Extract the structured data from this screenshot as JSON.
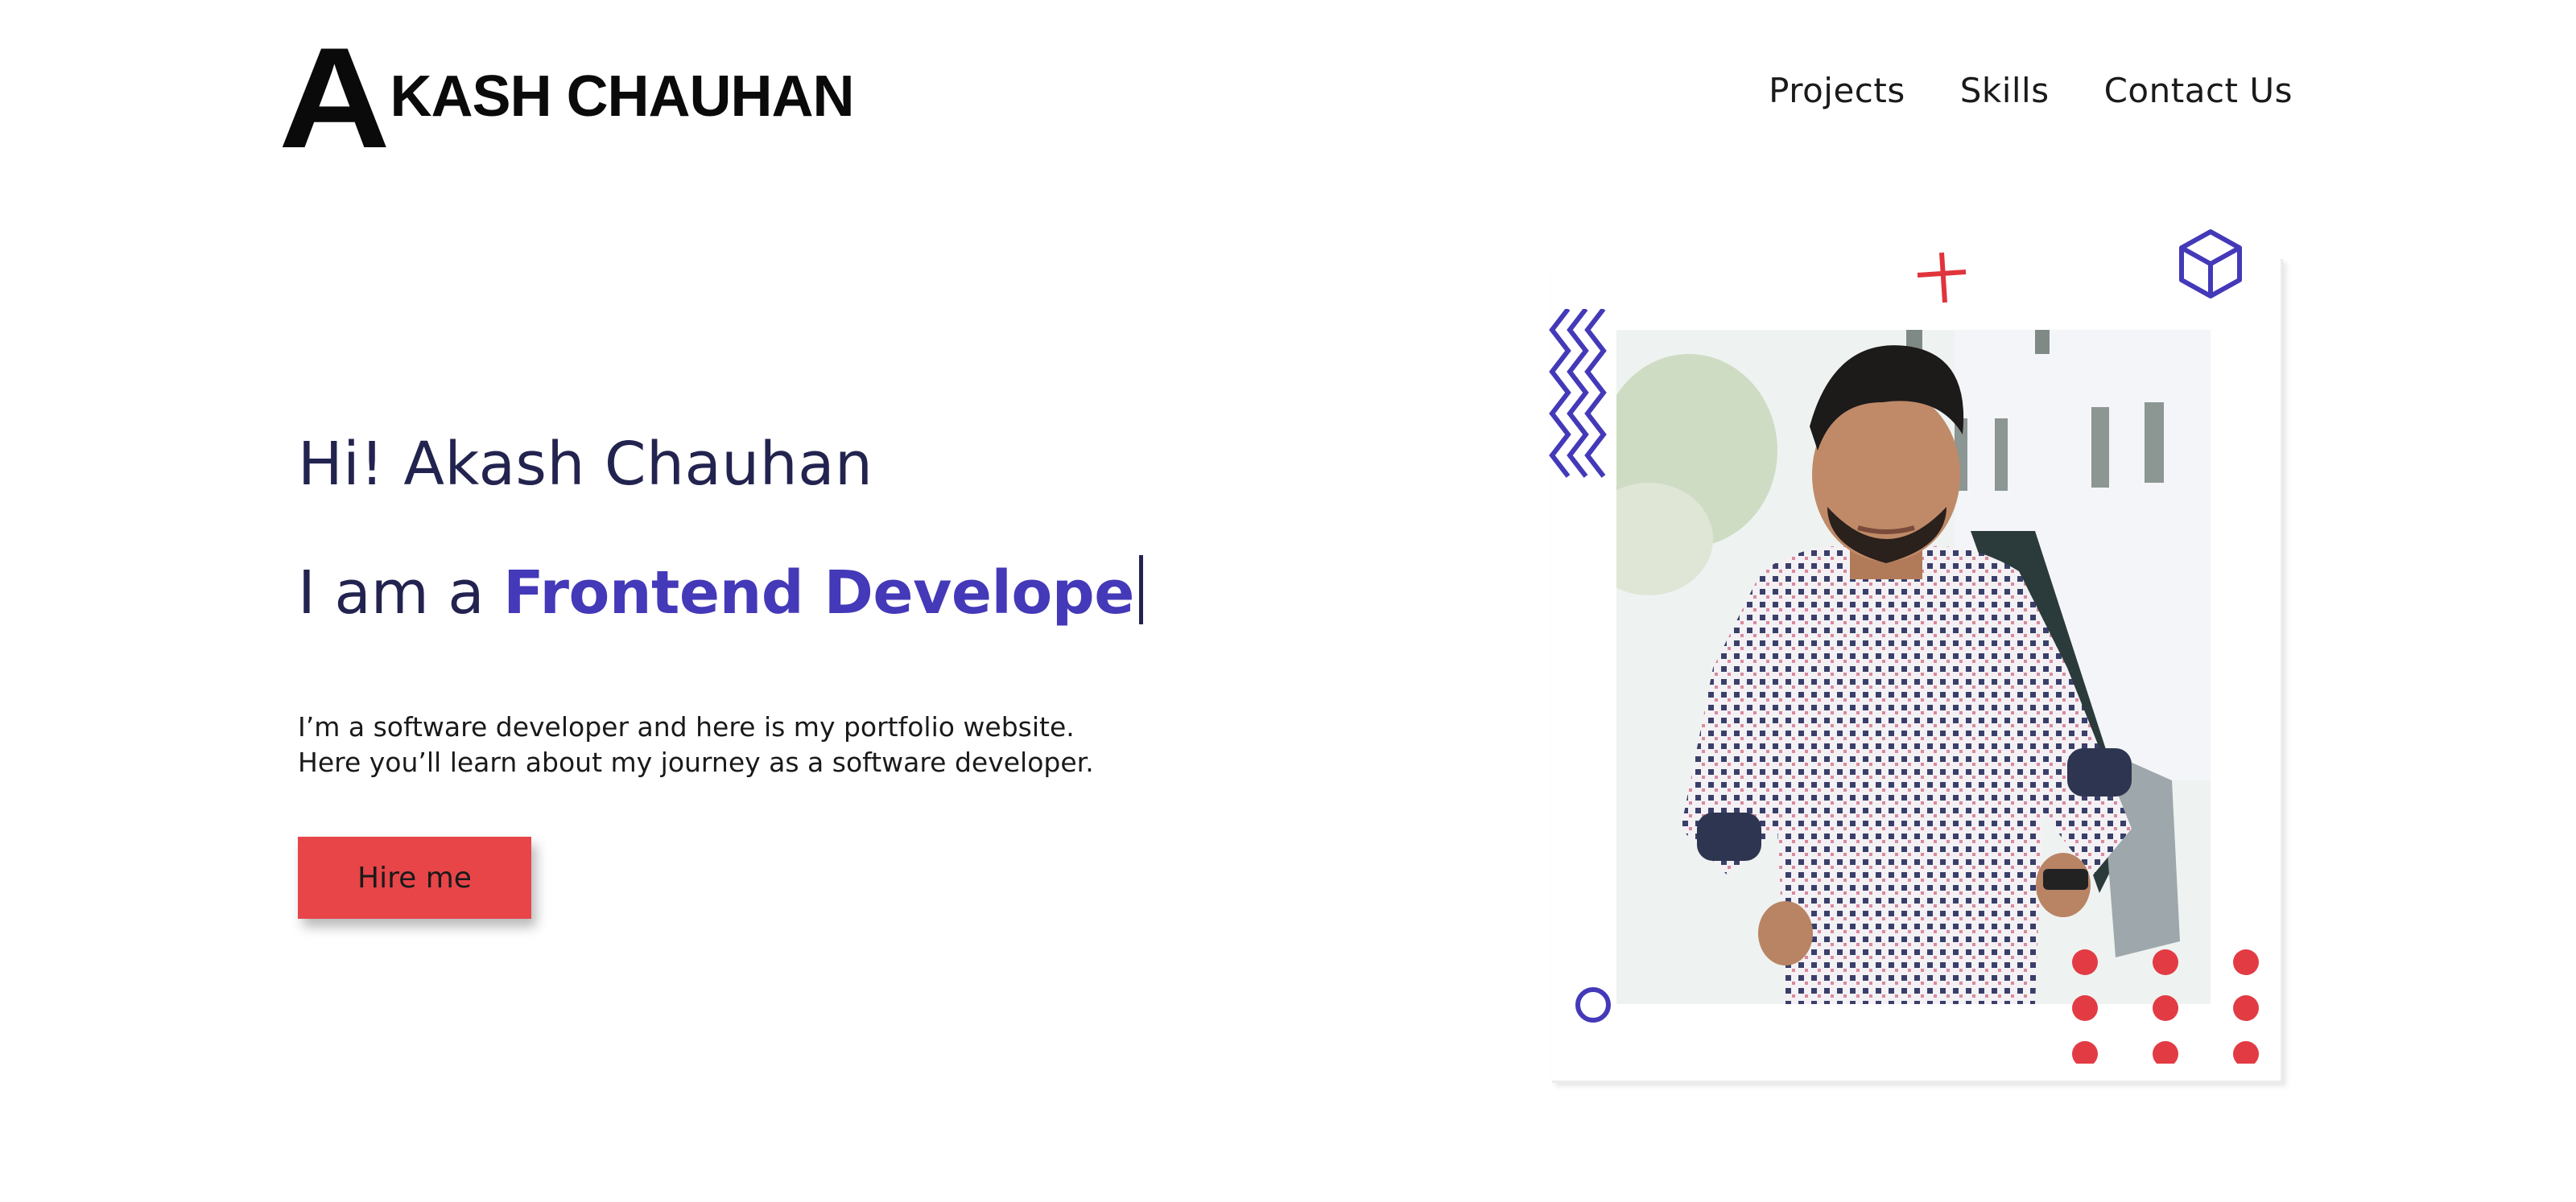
{
  "header": {
    "logo_initial": "A",
    "logo_rest": "KASH CHAUHAN",
    "nav": [
      "Projects",
      "Skills",
      "Contact Us"
    ]
  },
  "hero": {
    "greeting": "Hi! Akash Chauhan",
    "role_prefix": "I am a ",
    "role": "Frontend Develope",
    "description_line1": "I’m a software developer and here is my portfolio website.",
    "description_line2": "Here you’ll learn about my journey as a software developer.",
    "hire_button": "Hire me"
  },
  "decorations": {
    "icons": [
      "zigzag-icon",
      "plus-icon",
      "cube-icon",
      "circle-icon",
      "dots-grid-icon"
    ],
    "accent_purple": "#4439b8",
    "accent_red": "#e84549"
  }
}
